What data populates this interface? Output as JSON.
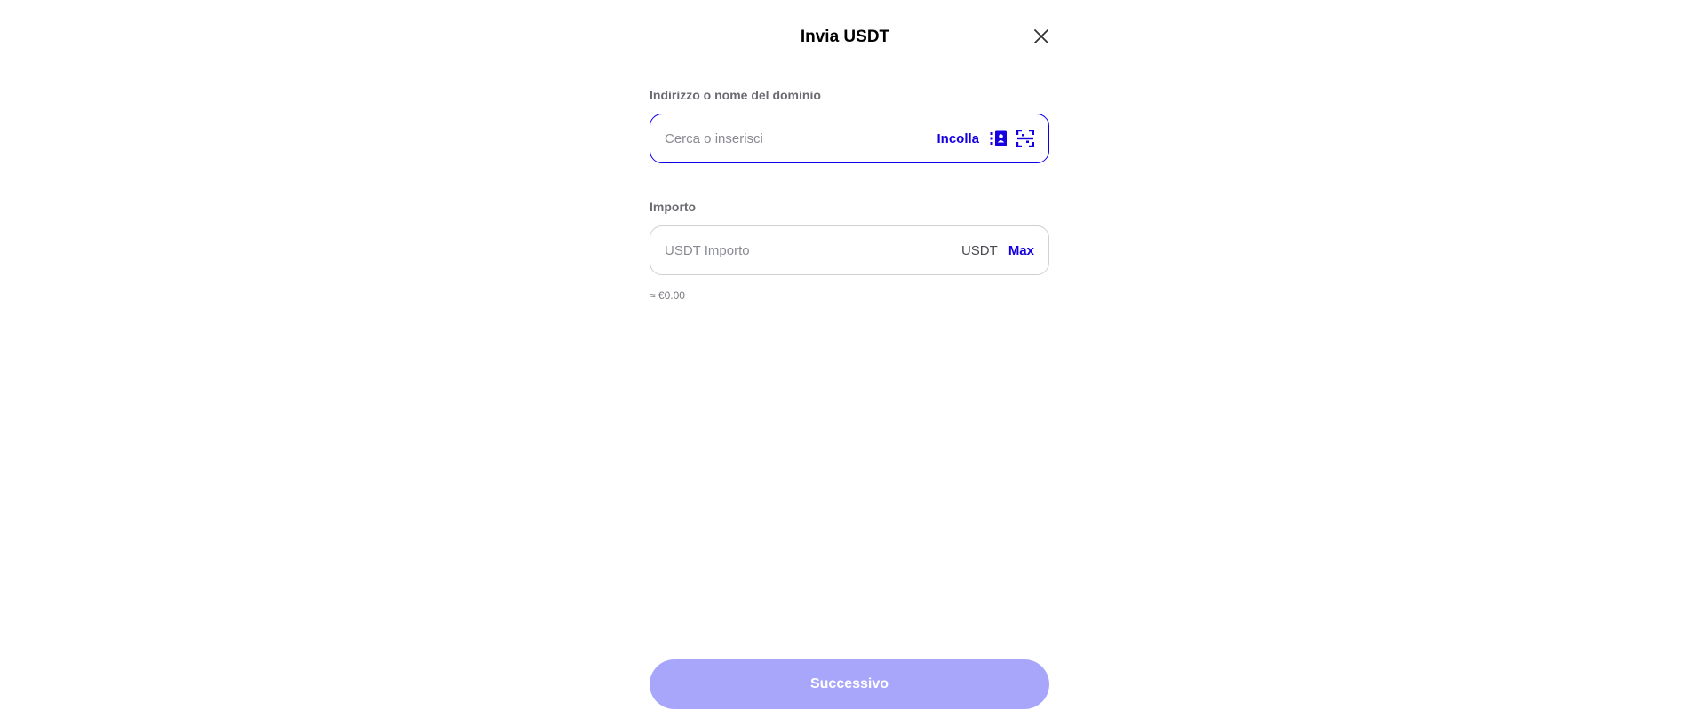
{
  "header": {
    "title": "Invia USDT",
    "close_icon": "close-icon"
  },
  "address_field": {
    "label": "Indirizzo o nome del dominio",
    "placeholder": "Cerca o inserisci",
    "value": "",
    "paste_label": "Incolla",
    "address_book_icon": "address-book-icon",
    "scan_icon": "qr-scan-icon"
  },
  "amount_field": {
    "label": "Importo",
    "placeholder": "USDT Importo",
    "value": "",
    "currency": "USDT",
    "max_label": "Max"
  },
  "fiat_estimate": "≈ €0.00",
  "footer": {
    "next_label": "Successivo"
  },
  "colors": {
    "accent": "#1400e0",
    "button_disabled": "#a8a6fb",
    "input_focus_border": "#0d00e6"
  }
}
